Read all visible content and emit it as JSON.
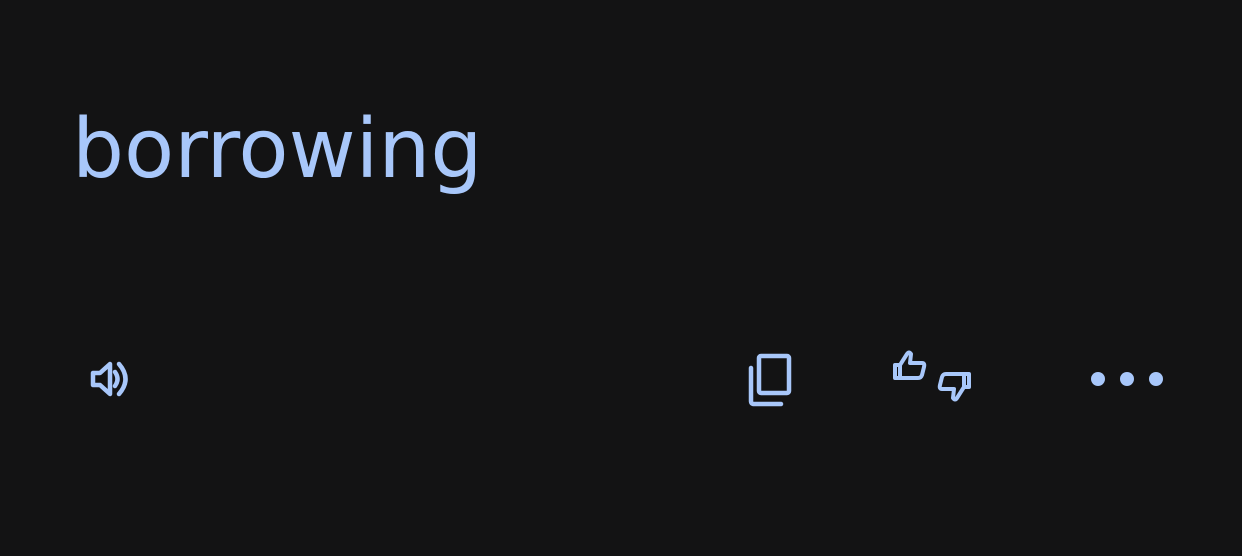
{
  "translation": {
    "text": "borrowing"
  },
  "actions": {
    "listen_icon": "speaker-icon",
    "copy_icon": "copy-icon",
    "feedback_icon": "thumbs-feedback-icon",
    "more_icon": "more-horiz-icon"
  },
  "colors": {
    "background": "#131314",
    "accent": "#a8c7fa"
  }
}
